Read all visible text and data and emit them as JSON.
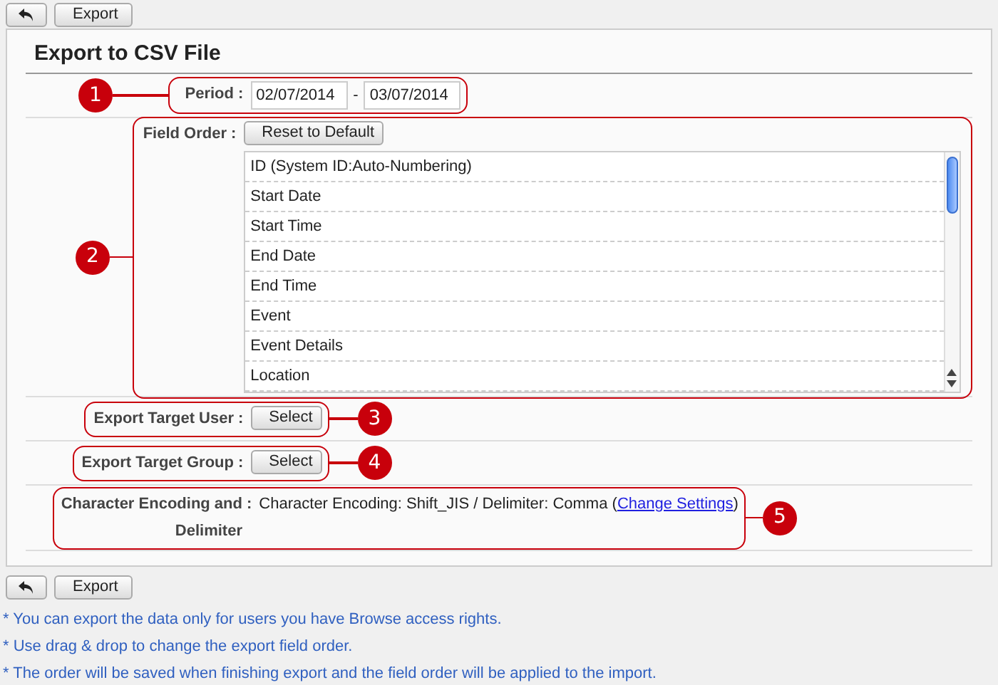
{
  "top_toolbar": {
    "export_button": "Export"
  },
  "title": "Export to CSV File",
  "rows": [
    {
      "kind": "period",
      "marker": "1",
      "label": "Period",
      "colon": ":",
      "start_date": "02/07/2014",
      "separator": "-",
      "end_date": "03/07/2014"
    },
    {
      "kind": "field_order",
      "marker": "2",
      "label": "Field Order",
      "colon": ":",
      "reset_button": "Reset to Default",
      "fields": [
        "ID (System ID:Auto-Numbering)",
        "Start Date",
        "Start Time",
        "End Date",
        "End Time",
        "Event",
        "Event Details",
        "Location"
      ]
    },
    {
      "kind": "user",
      "marker": "3",
      "label": "Export Target User",
      "colon": ":",
      "button": "Select"
    },
    {
      "kind": "group",
      "marker": "4",
      "label": "Export Target Group",
      "colon": ":",
      "button": "Select"
    },
    {
      "kind": "encoding",
      "marker": "5",
      "label": "Character Encoding and Delimiter",
      "colon": ":",
      "text_before": "Character Encoding: Shift_JIS / Delimiter: Comma (",
      "link": "Change Settings",
      "text_after": ")"
    }
  ],
  "bottom_toolbar": {
    "export_button": "Export"
  },
  "notes": [
    "* You can export the data only for users you have Browse access rights.",
    "* Use drag & drop to change the export field order.",
    "* The order will be saved when finishing export and the field order will be applied to the import."
  ]
}
